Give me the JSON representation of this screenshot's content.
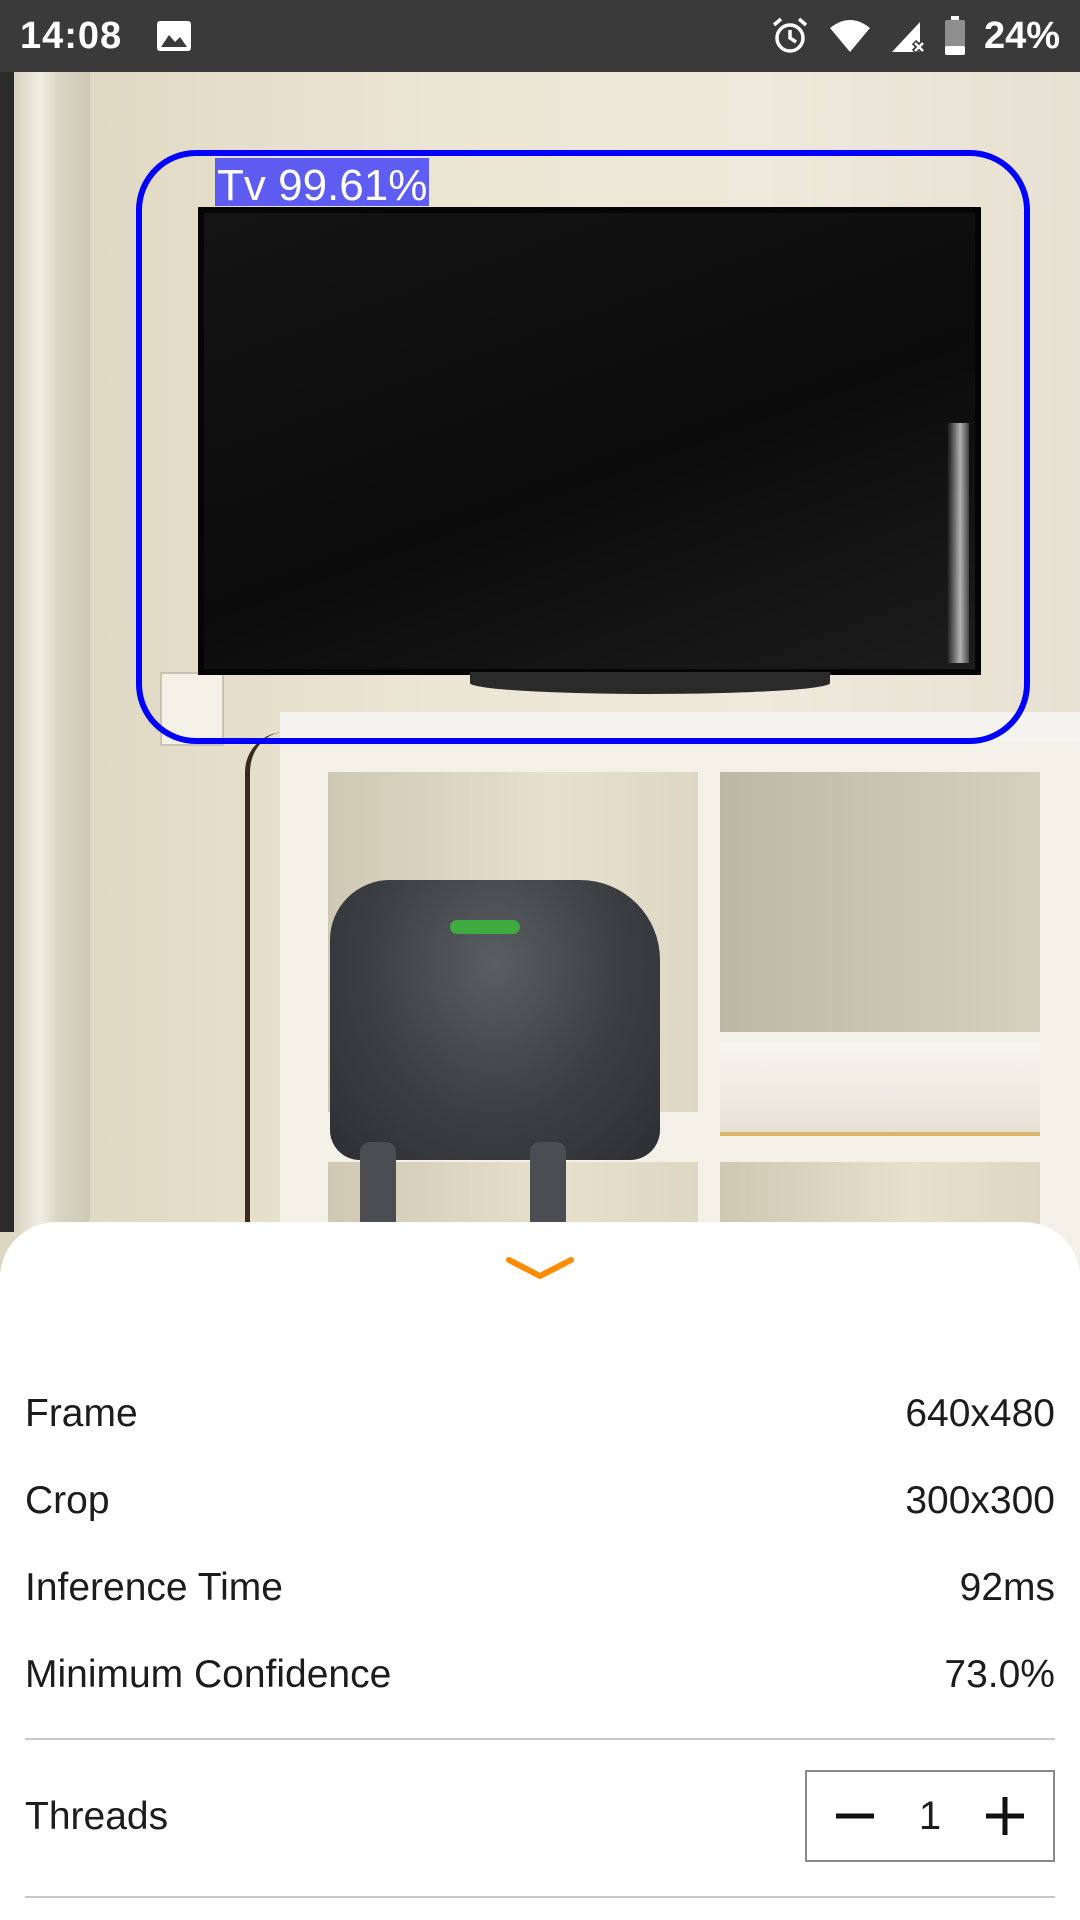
{
  "status_bar": {
    "time": "14:08",
    "battery_percent": "24%",
    "icons": [
      "image-notification-icon",
      "alarm-icon",
      "wifi-icon",
      "cell-signal-no-data-icon",
      "battery-icon"
    ]
  },
  "camera_preview": {
    "detection": {
      "label": "Tv 99.61%",
      "box_color": "#0000ff"
    }
  },
  "bottom_sheet": {
    "toggle_icon": "chevron-down-icon",
    "accent_color": "#ff8c00",
    "rows": [
      {
        "label": "Frame",
        "value": "640x480"
      },
      {
        "label": "Crop",
        "value": "300x300"
      },
      {
        "label": "Inference Time",
        "value": "92ms"
      },
      {
        "label": "Minimum Confidence",
        "value": "73.0%"
      }
    ],
    "threads": {
      "label": "Threads",
      "value": "1",
      "decrement_icon": "minus-icon",
      "increment_icon": "plus-icon"
    }
  }
}
